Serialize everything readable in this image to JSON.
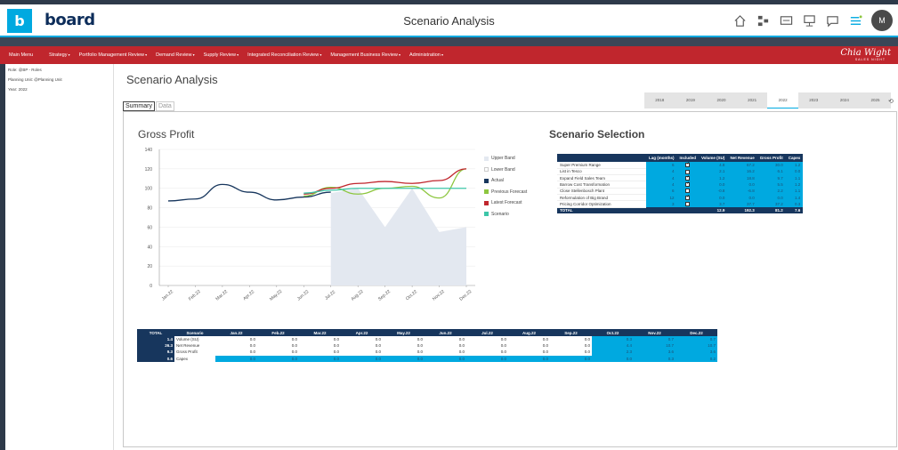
{
  "app": {
    "logo_letter": "b",
    "logo_text": "board",
    "title": "Scenario Analysis",
    "avatar": "M"
  },
  "menu": {
    "main": "Main Menu",
    "items": [
      "Strategy",
      "Portfolio Management Review",
      "Demand Review",
      "Supply Review",
      "Integrated Reconciliation Review",
      "Management Business Review",
      "Administration"
    ]
  },
  "brand": {
    "signature": "Chia Wight",
    "sub": "SALES NIGHT"
  },
  "left_panel": {
    "role": "Role: @BP - Roles",
    "planning_unit": "Planning Unit: @Planning Unit",
    "year": "Year: 2022"
  },
  "page": {
    "title": "Scenario Analysis",
    "tab_summary": "Summary",
    "tab_data": "Data",
    "years": [
      "2018",
      "2019",
      "2020",
      "2021",
      "2022",
      "2023",
      "2024",
      "2025"
    ],
    "active_year": "2022"
  },
  "gross_profit_title": "Gross Profit",
  "scenario_selection_title": "Scenario Selection",
  "chart_data": {
    "type": "line",
    "categories": [
      "Jan.22",
      "Feb.22",
      "Mar.22",
      "Apr.22",
      "May.22",
      "Jun.22",
      "Jul.22",
      "Aug.22",
      "Sep.22",
      "Oct.22",
      "Nov.22",
      "Dec.22"
    ],
    "ylim": [
      0,
      140
    ],
    "yticks": [
      0,
      20,
      40,
      60,
      80,
      100,
      120,
      140
    ],
    "series": [
      {
        "name": "Upper Band",
        "color": "#e3e8f0",
        "values": [
          null,
          null,
          null,
          null,
          null,
          null,
          95,
          100,
          60,
          100,
          55,
          60
        ]
      },
      {
        "name": "Lower Band",
        "color": "#ffffff",
        "values": [
          null,
          null,
          null,
          null,
          null,
          null,
          null,
          null,
          null,
          null,
          null,
          null
        ]
      },
      {
        "name": "Actual",
        "color": "#17365d",
        "values": [
          87,
          89,
          104,
          96,
          88,
          91,
          96,
          null,
          null,
          null,
          null,
          null
        ]
      },
      {
        "name": "Previous Forecast",
        "color": "#8dc63f",
        "values": [
          null,
          null,
          null,
          null,
          null,
          92,
          101,
          94,
          100,
          102,
          90,
          120
        ]
      },
      {
        "name": "Latest Forecast",
        "color": "#c0262d",
        "values": [
          null,
          null,
          null,
          null,
          null,
          94,
          100,
          105,
          107,
          105,
          108,
          120
        ]
      },
      {
        "name": "Scenario",
        "color": "#3cc6a8",
        "values": [
          null,
          null,
          null,
          null,
          null,
          95,
          98,
          100,
          100,
          100,
          100,
          100
        ]
      }
    ]
  },
  "scenario_table": {
    "headers": [
      "",
      "Lag (months)",
      "Included",
      "Volume (SU)",
      "Net Revenue",
      "Gross Profit",
      "Capex"
    ],
    "rows": [
      {
        "name": "Super Premium Range",
        "lag": "6",
        "included": true,
        "vol": "4.8",
        "rev": "67.2",
        "gp": "30.0",
        "capex": "1.2"
      },
      {
        "name": "List in Tesco",
        "lag": "4",
        "included": false,
        "vol": "2.1",
        "rev": "16.2",
        "gp": "6.1",
        "capex": "0.0"
      },
      {
        "name": "Expand Field Sales Team",
        "lag": "4",
        "included": true,
        "vol": "1.2",
        "rev": "18.8",
        "gp": "9.7",
        "capex": "1.1"
      },
      {
        "name": "Barrow Cost Transformation",
        "lag": "4",
        "included": true,
        "vol": "0.0",
        "rev": "0.0",
        "gp": "5.5",
        "capex": "1.2"
      },
      {
        "name": "Close Stellenbosch Plant",
        "lag": "6",
        "included": false,
        "vol": "-0.8",
        "rev": "-6.8",
        "gp": "2.2",
        "capex": "1.1"
      },
      {
        "name": "Reformulation of Big Brand",
        "lag": "12",
        "included": true,
        "vol": "0.0",
        "rev": "0.0",
        "gp": "0.0",
        "capex": "1.4"
      },
      {
        "name": "Pricing Corridor Optimization",
        "lag": "3",
        "included": false,
        "vol": "3.7",
        "rev": "37.7",
        "gp": "37.2",
        "capex": "0.3"
      }
    ],
    "total": {
      "name": "TOTAL",
      "vol": "12.9",
      "rev": "192.3",
      "gp": "81.2",
      "capex": "7.6"
    }
  },
  "bottom_table": {
    "headers": [
      "TOTAL",
      "Scenario",
      "Jan.22",
      "Feb.22",
      "Mar.22",
      "Apr.22",
      "May.22",
      "Jun.22",
      "Jul.22",
      "Aug.22",
      "Sep.22",
      "Oct.22",
      "Nov.22",
      "Dec.22"
    ],
    "rows": [
      {
        "total": "1.4",
        "label": "Volume (SU)",
        "values": [
          "0.0",
          "0.0",
          "0.0",
          "0.0",
          "0.0",
          "0.0",
          "0.0",
          "0.0",
          "0.0",
          "0.3",
          "0.7",
          "0.7"
        ]
      },
      {
        "total": "26.3",
        "label": "Net Revenue",
        "values": [
          "0.0",
          "0.0",
          "0.0",
          "0.0",
          "0.0",
          "0.0",
          "0.0",
          "0.0",
          "0.0",
          "4.4",
          "10.7",
          "10.7"
        ]
      },
      {
        "total": "9.3",
        "label": "Gross Profit",
        "values": [
          "0.0",
          "0.0",
          "0.0",
          "0.0",
          "0.0",
          "0.0",
          "0.0",
          "0.0",
          "0.0",
          "2.3",
          "3.6",
          "3.6"
        ]
      },
      {
        "total": "0.6",
        "label": "Capex",
        "values": [
          "0.0",
          "0.0",
          "0.0",
          "0.0",
          "0.0",
          "0.0",
          "0.0",
          "0.0",
          "0.0",
          "0.0",
          "0.3",
          "0.2"
        ]
      }
    ]
  }
}
